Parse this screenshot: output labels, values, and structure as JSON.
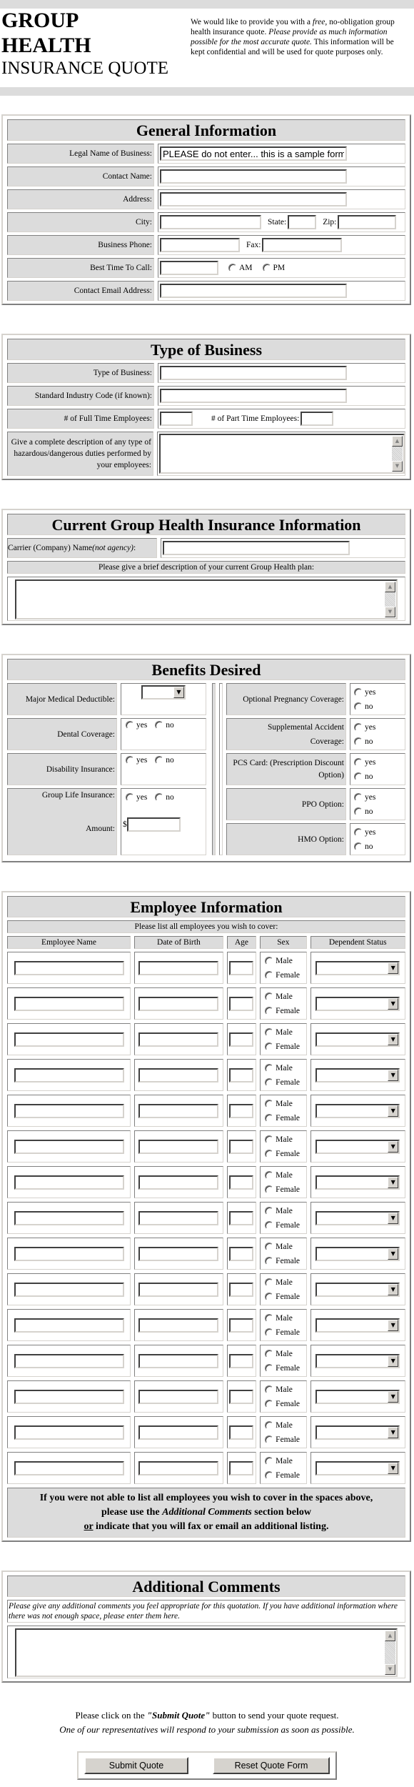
{
  "header": {
    "title_line1": "GROUP",
    "title_line2": "HEALTH",
    "title_line3": "INSURANCE QUOTE",
    "intro_a": "We would like to provide you with a ",
    "intro_free": "free",
    "intro_b": ", no-obligation group health insurance quote. ",
    "intro_italic": "Please provide as much information possible for the most accurate quote.",
    "intro_c": " This information will be kept confidential and will be used for quote purposes only."
  },
  "general": {
    "title": "General Information",
    "legal_name_label": "Legal Name of Business:",
    "legal_name_value": "PLEASE do not enter... this is a sample form",
    "contact_name_label": "Contact Name:",
    "address_label": "Address:",
    "city_label": "City:",
    "state_label": "State:",
    "zip_label": "Zip:",
    "phone_label": "Business Phone:",
    "fax_label": "Fax:",
    "best_time_label": "Best Time To Call:",
    "am_label": "AM",
    "pm_label": "PM",
    "email_label": "Contact Email Address:"
  },
  "business": {
    "title": "Type of Business",
    "type_label": "Type of Business:",
    "sic_label": "Standard Industry Code (if known):",
    "fulltime_label": "# of Full Time Employees:",
    "parttime_label": "# of Part Time Employees:",
    "hazard_label": "Give a complete description of any type of hazardous/dangerous duties performed by your employees:"
  },
  "current": {
    "title": "Current Group Health Insurance Information",
    "carrier_label": "Carrier (Company) Name ",
    "carrier_label_italic": "(not agency)",
    "carrier_label_colon": ":",
    "plan_desc_label": "Please give a brief description of your current Group Health plan:"
  },
  "benefits": {
    "title": "Benefits Desired",
    "yes": "yes",
    "no": "no",
    "left": [
      {
        "label": "Major Medical Deductible:",
        "kind": "select"
      },
      {
        "label": "Dental Coverage:",
        "kind": "yesno"
      },
      {
        "label": "Disability Insurance:",
        "kind": "yesno"
      }
    ],
    "life_label": "Group Life Insurance:",
    "amount_label": "Amount:",
    "dollar": "$",
    "right": [
      {
        "label": "Optional Pregnancy Coverage:"
      },
      {
        "label": "Supplemental Accident Coverage:"
      },
      {
        "label": "PCS Card: (Prescription Discount Option)"
      },
      {
        "label": "PPO Option:"
      },
      {
        "label": "HMO Option:"
      }
    ]
  },
  "employees": {
    "title": "Employee Information",
    "subtitle": "Please list all employees you wish to cover:",
    "columns": [
      "Employee Name",
      "Date of Birth",
      "Age",
      "Sex",
      "Dependent Status"
    ],
    "male": "Male",
    "female": "Female",
    "row_count": 15,
    "notice_line1": "If you were not able to list all employees you wish to cover in the spaces above,",
    "notice_line2a": "please use the ",
    "notice_line2_italic": "Additional Comments",
    "notice_line2b": " section below",
    "notice_or": "or",
    "notice_line3": " indicate that you will fax or email an additional listing."
  },
  "comments": {
    "title": "Additional Comments",
    "instructions": "Please give any additional comments you feel appropriate for this quotation. If you have additional information where there was not enough space, please enter them here."
  },
  "footer": {
    "line1a": "Please click on the ",
    "line1_bold": "\"Submit Quote\"",
    "line1b": " button to send your quote request.",
    "line2": "One of our representatives will respond to your submission as soon as possible.",
    "submit_label": "Submit Quote",
    "reset_label": "Reset Quote Form"
  }
}
